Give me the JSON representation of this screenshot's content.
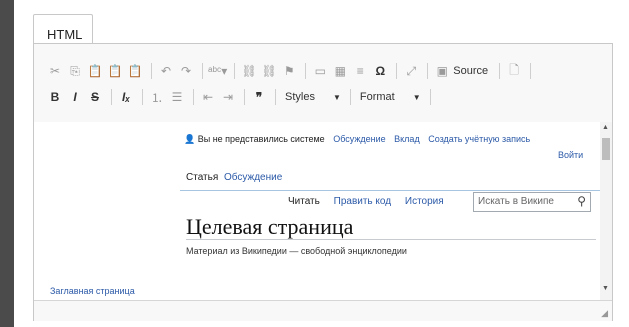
{
  "tab": {
    "label": "HTML"
  },
  "toolbar": {
    "row1": {
      "source_label": "Source"
    },
    "row2": {
      "styles_label": "Styles",
      "format_label": "Format"
    }
  },
  "wiki": {
    "not_logged_in": "Вы не представились системе",
    "discussion_link": "Обсуждение",
    "contrib_link": "Вклад",
    "create_account_link": "Создать учётную запись",
    "login_link": "Войти",
    "tab_article": "Статья",
    "tab_talk": "Обсуждение",
    "view_read": "Читать",
    "view_edit": "Править код",
    "view_history": "История",
    "search_placeholder": "Искать в Википе",
    "heading": "Целевая страница",
    "tagline": "Материал из Википедии — свободной энциклопедии",
    "main_page_link": "Заглавная страница"
  }
}
